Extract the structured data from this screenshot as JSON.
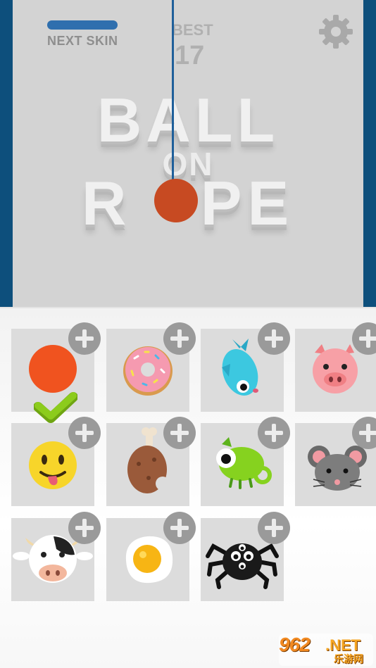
{
  "hud": {
    "next_skin_label": "NEXT SKIN",
    "next_skin_progress": 1.0,
    "best_label": "BEST",
    "best_value": "17"
  },
  "title": {
    "line1": "BALL",
    "line2": "ON",
    "line3": "R   PE"
  },
  "colors": {
    "frame": "#0d4f7c",
    "board": "#d3d3d3",
    "ball": "#c74a22",
    "rope": "#1f5f9a",
    "progress": "#2f6fae",
    "card": "#dcdcdc",
    "plus_button": "#9a9a9a",
    "selected_check": "#8ccc1c"
  },
  "skins": [
    {
      "name": "orange-ball",
      "icon": "orange-ball-icon",
      "selected": true
    },
    {
      "name": "donut",
      "icon": "donut-icon",
      "selected": false
    },
    {
      "name": "fish",
      "icon": "fish-icon",
      "selected": false
    },
    {
      "name": "pig",
      "icon": "pig-icon",
      "selected": false
    },
    {
      "name": "emoji",
      "icon": "emoji-face-icon",
      "selected": false
    },
    {
      "name": "chicken-leg",
      "icon": "chicken-leg-icon",
      "selected": false
    },
    {
      "name": "chameleon",
      "icon": "chameleon-icon",
      "selected": false
    },
    {
      "name": "mouse",
      "icon": "mouse-icon",
      "selected": false
    },
    {
      "name": "cow",
      "icon": "cow-icon",
      "selected": false
    },
    {
      "name": "fried-egg",
      "icon": "fried-egg-icon",
      "selected": false
    },
    {
      "name": "spider",
      "icon": "spider-icon",
      "selected": false
    }
  ],
  "watermark": {
    "brand": "962",
    "suffix": ".NET",
    "subtitle": "乐游网"
  }
}
